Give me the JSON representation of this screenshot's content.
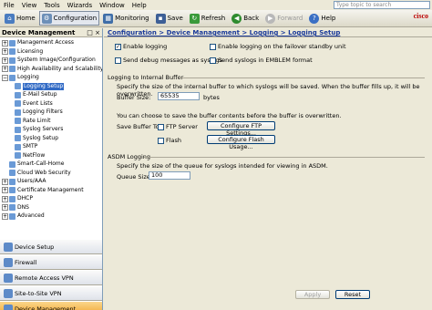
{
  "menu": [
    "File",
    "View",
    "Tools",
    "Wizards",
    "Window",
    "Help"
  ],
  "search": {
    "placeholder": "Type topic to search",
    "go": "Go"
  },
  "toolbar": {
    "home": "Home",
    "configuration": "Configuration",
    "monitoring": "Monitoring",
    "save": "Save",
    "refresh": "Refresh",
    "back": "Back",
    "forward": "Forward",
    "help": "Help"
  },
  "brand": "cisco",
  "left_panel": {
    "title": "Device Management",
    "close": "□ ×",
    "tree": [
      {
        "label": "Management Access",
        "depth": 0,
        "exp": "+"
      },
      {
        "label": "Licensing",
        "depth": 0,
        "exp": "+"
      },
      {
        "label": "System Image/Configuration",
        "depth": 0,
        "exp": "+"
      },
      {
        "label": "High Availability and Scalability",
        "depth": 0,
        "exp": "+"
      },
      {
        "label": "Logging",
        "depth": 0,
        "exp": "−"
      },
      {
        "label": "Logging Setup",
        "depth": 1,
        "selected": true
      },
      {
        "label": "E-Mail Setup",
        "depth": 1
      },
      {
        "label": "Event Lists",
        "depth": 1
      },
      {
        "label": "Logging Filters",
        "depth": 1
      },
      {
        "label": "Rate Limit",
        "depth": 1
      },
      {
        "label": "Syslog Servers",
        "depth": 1
      },
      {
        "label": "Syslog Setup",
        "depth": 1
      },
      {
        "label": "SMTP",
        "depth": 1
      },
      {
        "label": "NetFlow",
        "depth": 1
      },
      {
        "label": "Smart-Call-Home",
        "depth": 0,
        "exp": ""
      },
      {
        "label": "Cloud Web Security",
        "depth": 0,
        "exp": ""
      },
      {
        "label": "Users/AAA",
        "depth": 0,
        "exp": "+"
      },
      {
        "label": "Certificate Management",
        "depth": 0,
        "exp": "+"
      },
      {
        "label": "DHCP",
        "depth": 0,
        "exp": "+"
      },
      {
        "label": "DNS",
        "depth": 0,
        "exp": "+"
      },
      {
        "label": "Advanced",
        "depth": 0,
        "exp": "+"
      }
    ],
    "nav_buttons": [
      {
        "label": "Device Setup",
        "active": false
      },
      {
        "label": "Firewall",
        "active": false
      },
      {
        "label": "Remote Access VPN",
        "active": false
      },
      {
        "label": "Site-to-Site VPN",
        "active": false
      },
      {
        "label": "Device Management",
        "active": true
      }
    ]
  },
  "content": {
    "breadcrumb": "Configuration > Device Management > Logging > Logging Setup",
    "enable_logging": "Enable logging",
    "enable_logging_checked": true,
    "enable_failover": "Enable logging on the failover standby unit",
    "send_debug": "Send debug messages as syslogs",
    "send_emblem": "Send syslogs in EMBLEM format",
    "buffer_section": "Logging to Internal Buffer",
    "buffer_desc": "Specify the size of the internal buffer to which syslogs will be saved. When the buffer fills up, it will be overwritten.",
    "buffer_size_label": "Buffer Size:",
    "buffer_size_value": "65535",
    "buffer_unit": "bytes",
    "save_desc": "You can choose to save the buffer contents before the buffer is overwritten.",
    "save_buffer_to": "Save Buffer To:",
    "ftp_server": "FTP Server",
    "flash": "Flash",
    "configure_ftp": "Configure FTP Settings...",
    "configure_flash": "Configure Flash Usage...",
    "asdm_section": "ASDM Logging",
    "asdm_desc": "Specify the size of the queue for syslogs intended for viewing in ASDM.",
    "queue_size_label": "Queue Size:",
    "queue_size_value": "100",
    "apply": "Apply",
    "reset": "Reset"
  }
}
